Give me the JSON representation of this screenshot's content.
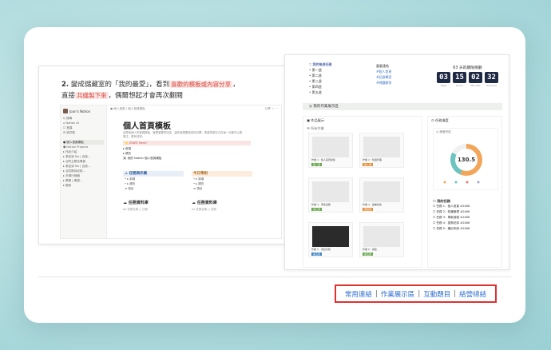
{
  "left_slide": {
    "step_number": "2.",
    "line1_a": "變成儲藏室的「我的最愛」，看到",
    "line1_highlight": "喜歡的模板或內容分享",
    "line1_b": "，",
    "line2_a": "直接",
    "line2_highlight": "共繕製下來",
    "line2_b": "，偶爾想起才會再次翻閱",
    "notion": {
      "workspace": "Joan's Notion",
      "sidebar_items": [
        "Q 搜尋",
        "⌂ Notion AI",
        "☐ 首頁",
        "✉ 收件匣",
        "",
        "● 個人首頁模板",
        "⬢ Notion Projects",
        "▸ 作品介紹",
        "▸ 參加到 Mo | 自我…",
        "▸ 合同主題化專頁",
        "▸ 參加到 Mo | 自我…",
        "▸ 合同期待紀錄…",
        "▸ 市場行銷器",
        "▸ 學寶 | 期望…",
        "▸ 範例"
      ],
      "breadcrumb": "● 個人首頁 / 個人首頁模板",
      "top_right": "分享  ☆  ⋯",
      "title": "個人首頁模板",
      "description": "這是我個人的首頁模板，管理重要的訊息，還有我想要達成的目標，希望幫助自己在每一天都可以更專注、更有效率。",
      "callout": "⭐ START Here!",
      "bullet1": "▸ 新增",
      "bullet2": "▸ 擴充",
      "link_line": "⛓ 我的 Notion 個人首頁模板",
      "col1_header": "⊥ 任務與作業",
      "col1_rows": [
        "• ▸ 新增",
        "• ▸ 擴充",
        "≡ 項目"
      ],
      "col2_header": "今日準則",
      "col2_rows": [
        "• ▸ 新增",
        "• ▸ 擴充",
        "≡ 項目"
      ],
      "sub1": "☁ 任務資料庫",
      "sub2": "☁ 任務資料庫",
      "db1": "Aa 任務名稱   ◷ 日期",
      "db2": "Aa 任務名稱   ◷ 狀態"
    }
  },
  "right_slide": {
    "list_heading": "▽ 我的每週任務",
    "list_items": [
      "• 第一週",
      "• 第二週",
      "• 第三週",
      "• 第四週",
      "• 第五週"
    ],
    "mid_heading": "重要連結",
    "mid_items": [
      "#個人首頁",
      "#記錄專案",
      "#問題解答"
    ],
    "countdown_title": "63 天的期限倒數",
    "countdown": [
      "03",
      "15",
      "02",
      "32"
    ],
    "countdown_labels": [
      "Days",
      "Hours",
      "Minutes",
      "Seconds"
    ],
    "section_bar": "◎ 我的作業展示區",
    "works_heading": "▣ 作品展示",
    "works_sub": "☰ 所有作業",
    "works": [
      {
        "caption": "作業 1：個人首頁模板",
        "tag": "第一週"
      },
      {
        "caption": "作業 2：知識管理",
        "tag": "第二週"
      },
      {
        "caption": "作業 3：專案追蹤",
        "tag": "第三週"
      },
      {
        "caption": "作業 4：讀書紀錄",
        "tag": "第四週"
      },
      {
        "caption": "作業 5：筆記系統",
        "tag": "第五週"
      },
      {
        "caption": "作業 6：總結",
        "tag": "第五週"
      }
    ],
    "progress_heading": "◷ 任務進度",
    "progress_sub": "◷ 進度完成",
    "donut_value": "130.5",
    "tasks_heading": "☐ 我的任務",
    "tasks": [
      "☐ 任務 1：個人首頁 #2486",
      "☐ 任務 2：知識管理 #2486",
      "☐ 任務 3：專案追蹤 #2486",
      "☐ 任務 4：讀書紀錄 #2486",
      "☐ 任務 5：筆記系統 #2486"
    ]
  },
  "bottom_nav": {
    "links": [
      "常用連結",
      "作業展示區",
      "互動題目",
      "結營總結"
    ],
    "separator": "|",
    "border_color": "#e03131",
    "link_color": "#2f6fd1"
  },
  "colors": {
    "background": "#b7dfe1",
    "highlight_red": "#d6453c",
    "countdown_box": "#1f2a44"
  }
}
